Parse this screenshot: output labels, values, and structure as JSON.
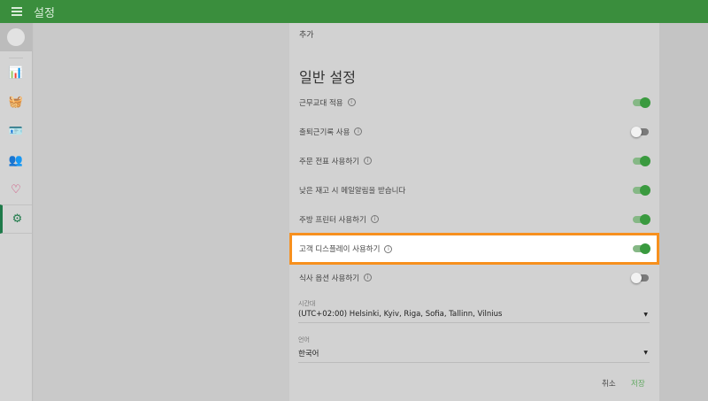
{
  "header": {
    "title": "설정",
    "menu_icon": "hamburger-icon"
  },
  "sidebar": {
    "items": [
      {
        "icon": "bar-chart-icon",
        "color": "#3a9a3f",
        "glyph": "📊"
      },
      {
        "icon": "basket-icon",
        "color": "#d0356b",
        "glyph": "🧺"
      },
      {
        "icon": "id-card-icon",
        "color": "#1f7a6a",
        "glyph": "🪪"
      },
      {
        "icon": "users-icon",
        "color": "#2f5fa8",
        "glyph": "👥"
      },
      {
        "icon": "heart-icon",
        "color": "#d0356b",
        "glyph": "♡"
      },
      {
        "icon": "gear-icon",
        "color": "#1f7a4a",
        "glyph": "⚙",
        "active": true
      }
    ]
  },
  "main": {
    "add_label": "추가",
    "section_title": "일반 설정",
    "settings": [
      {
        "label": "근무교대 적용",
        "info": true,
        "on": true
      },
      {
        "label": "출퇴근기록 사용",
        "info": true,
        "on": false
      },
      {
        "label": "주문 전표 사용하기",
        "info": true,
        "on": true
      },
      {
        "label": "낮은 재고 시 메일알림을 받습니다",
        "info": false,
        "on": true
      },
      {
        "label": "주방 프린터 사용하기",
        "info": true,
        "on": true
      },
      {
        "label": "고객 디스플레이 사용하기",
        "info": true,
        "on": true,
        "highlighted": true
      },
      {
        "label": "식사 옵션 사용하기",
        "info": true,
        "on": false
      }
    ],
    "timezone": {
      "label": "시간대",
      "value": "(UTC+02:00) Helsinki, Kyiv, Riga, Sofia, Tallinn, Vilnius"
    },
    "language": {
      "label": "언어",
      "value": "한국어"
    },
    "cancel_label": "취소",
    "save_label": "저장",
    "highlight_color": "#f7901e",
    "accent_color": "#3a9a3f"
  }
}
